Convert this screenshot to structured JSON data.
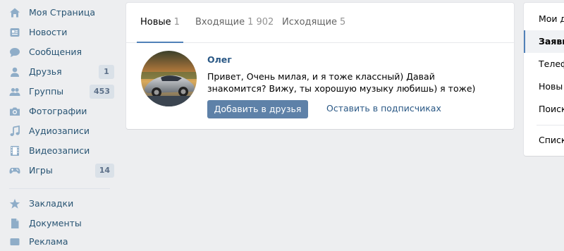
{
  "sidebar": {
    "items": [
      {
        "label": "Моя Страница",
        "icon": "home-icon",
        "count": null
      },
      {
        "label": "Новости",
        "icon": "news-icon",
        "count": null
      },
      {
        "label": "Сообщения",
        "icon": "messages-icon",
        "count": null
      },
      {
        "label": "Друзья",
        "icon": "friends-icon",
        "count": "1"
      },
      {
        "label": "Группы",
        "icon": "groups-icon",
        "count": "453"
      },
      {
        "label": "Фотографии",
        "icon": "photos-icon",
        "count": null
      },
      {
        "label": "Аудиозаписи",
        "icon": "audio-icon",
        "count": null
      },
      {
        "label": "Видеозаписи",
        "icon": "video-icon",
        "count": null
      },
      {
        "label": "Игры",
        "icon": "games-icon",
        "count": "14"
      },
      {
        "label": "Закладки",
        "icon": "bookmarks-icon",
        "count": null
      },
      {
        "label": "Документы",
        "icon": "documents-icon",
        "count": null
      },
      {
        "label": "Реклама",
        "icon": "ads-icon",
        "count": null
      }
    ]
  },
  "tabs": [
    {
      "label": "Новые",
      "count": "1",
      "active": true
    },
    {
      "label": "Входящие",
      "count": "1 902",
      "active": false
    },
    {
      "label": "Исходящие",
      "count": "5",
      "active": false
    }
  ],
  "request": {
    "name": "Олег",
    "message": "Привет, Очень милая, и я тоже классный) Давай знакомится? Вижу, ты хорошую музыку любишь) я тоже)",
    "add_button": "Добавить в друзья",
    "keep_link": "Оставить в подписчиках"
  },
  "right_menu": {
    "items": [
      "Мои д",
      "Заявк",
      "Телеф",
      "Новы",
      "Поиск",
      "Списк"
    ],
    "selected_index": 1
  },
  "colors": {
    "accent": "#5181b8",
    "link": "#2a5885",
    "sidebar_icon": "#8fadc8",
    "button": "#5e81a8",
    "background": "#edeef0"
  }
}
